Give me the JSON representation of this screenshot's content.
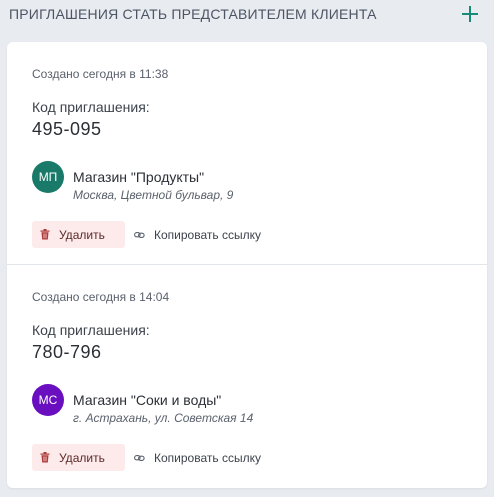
{
  "header": {
    "title": "ПРИГЛАШЕНИЯ СТАТЬ ПРЕДСТАВИТЕЛЕМ КЛИЕНТА",
    "add_icon": "plus-icon",
    "accent_color": "#1a8a78"
  },
  "invitations": [
    {
      "created": "Создано сегодня в 11:38",
      "code_label": "Код приглашения:",
      "code": "495-095",
      "avatar_initials": "МП",
      "avatar_color": "#1a7a6a",
      "store_name": "Магазин \"Продукты\"",
      "store_address": "Москва, Цветной бульвар, 9",
      "delete_label": "Удалить",
      "delete_icon": "trash-icon",
      "copy_label": "Копировать ссылку",
      "copy_icon": "link-icon"
    },
    {
      "created": "Создано сегодня в 14:04",
      "code_label": "Код приглашения:",
      "code": "780-796",
      "avatar_initials": "МС",
      "avatar_color": "#6a0fc0",
      "store_name": "Магазин \"Соки и воды\"",
      "store_address": "г. Астрахань, ул. Советская 14",
      "delete_label": "Удалить",
      "delete_icon": "trash-icon",
      "copy_label": "Копировать ссылку",
      "copy_icon": "link-icon"
    }
  ]
}
